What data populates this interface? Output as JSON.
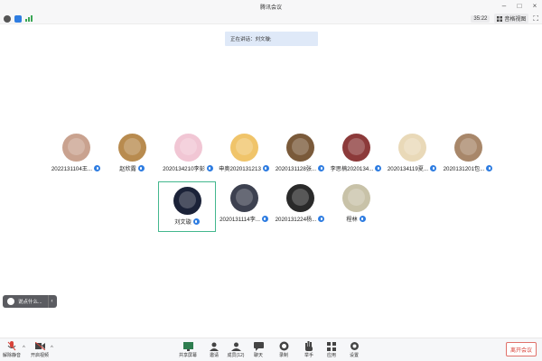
{
  "window": {
    "title": "腾讯会议"
  },
  "infobar": {
    "timer": "35:22",
    "view_label": "音格视图"
  },
  "speaking": {
    "text": "正在讲话：刘文璇;"
  },
  "participants": [
    {
      "name": "2022131104王...",
      "active": false,
      "avatar_bg": "#c9a28f"
    },
    {
      "name": "赵欣露",
      "active": false,
      "avatar_bg": "#b88b4f"
    },
    {
      "name": "2020134210李彭",
      "active": false,
      "avatar_bg": "#f1c6d4"
    },
    {
      "name": "申奥2020131213",
      "active": false,
      "avatar_bg": "#f0c46a"
    },
    {
      "name": "2020131128张...",
      "active": false,
      "avatar_bg": "#7a5a3a"
    },
    {
      "name": "李思楠2020134...",
      "active": false,
      "avatar_bg": "#8c3a3a"
    },
    {
      "name": "2020134119夏...",
      "active": false,
      "avatar_bg": "#e9d9b8"
    },
    {
      "name": "2020131201包...",
      "active": false,
      "avatar_bg": "#a8876a"
    },
    {
      "name": "刘文璇",
      "active": true,
      "avatar_bg": "#1b2238"
    },
    {
      "name": "2020131114李...",
      "active": false,
      "avatar_bg": "#3d4150"
    },
    {
      "name": "2020131224杨...",
      "active": false,
      "avatar_bg": "#2a2a2a"
    },
    {
      "name": "程林",
      "active": false,
      "avatar_bg": "#c8c2a8"
    }
  ],
  "chat": {
    "placeholder": "说点什么..."
  },
  "toolbar": {
    "unmute": "解除静音",
    "video": "开启视频",
    "share": "共享屏幕",
    "invite": "邀请",
    "members": "成员(12)",
    "chat": "聊天",
    "record": "录制",
    "raise_hand": "举手",
    "apps": "应用",
    "settings": "设置",
    "leave": "离开会议"
  },
  "colors": {
    "accent": "#2f7de1",
    "active_border": "#43b78e",
    "leave": "#d8433a"
  }
}
